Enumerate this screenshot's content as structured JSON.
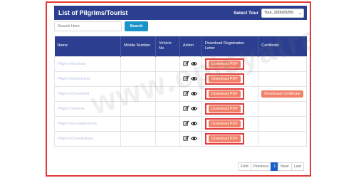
{
  "header": {
    "title": "List of Pilgrims/Tourist",
    "select_tour_label": "Select Tour",
    "tour_value": "Tour_200020250"
  },
  "search": {
    "placeholder": "Search Here",
    "button_label": "Search"
  },
  "table": {
    "columns": [
      "Name",
      "Mobile Number",
      "Vehicle No",
      "Action",
      "Download Registration Letter",
      "Certificate"
    ],
    "rows": [
      {
        "name": "Pilgrim Harshad",
        "download": "Download PDF",
        "certificate": ""
      },
      {
        "name": "Pilgrim Ramchand",
        "download": "Download PDF",
        "certificate": ""
      },
      {
        "name": "Pilgrim Chandrant",
        "download": "Download PDF",
        "certificate": "Download Certificate"
      },
      {
        "name": "Pilgrim Sharma",
        "download": "Download PDF",
        "certificate": ""
      },
      {
        "name": "Pilgrim Kamalakumudi",
        "download": "Download PDF",
        "certificate": ""
      },
      {
        "name": "Pilgrim Chandrakala",
        "download": "Download PDF",
        "certificate": ""
      }
    ]
  },
  "pagination": {
    "first": "First",
    "previous": "Previous",
    "current": "1",
    "next": "Next",
    "last": "Last"
  },
  "watermark": "www.epicyatra.in",
  "colors": {
    "header_bg": "#2c3e8f",
    "search_btn": "#1a93c9",
    "pdf_btn": "#f08068",
    "highlight_border": "#e23a3a",
    "active_page": "#1a5fc9"
  }
}
